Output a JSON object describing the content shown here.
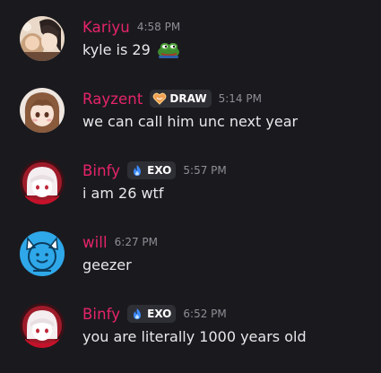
{
  "messages": [
    {
      "username": "Kariyu",
      "timestamp": "4:58 PM",
      "text": "kyle is 29",
      "emoji": "pepe-frog-emoji"
    },
    {
      "username": "Rayzent",
      "badge": {
        "icon": "heart-icon",
        "label": "DRAW"
      },
      "timestamp": "5:14 PM",
      "text": "we can call him unc next year"
    },
    {
      "username": "Binfy",
      "badge": {
        "icon": "flame-icon",
        "label": "EXO"
      },
      "timestamp": "5:57 PM",
      "text": "i am 26 wtf"
    },
    {
      "username": "will",
      "timestamp": "6:27 PM",
      "text": "geezer"
    },
    {
      "username": "Binfy",
      "badge": {
        "icon": "flame-icon",
        "label": "EXO"
      },
      "timestamp": "6:52 PM",
      "text": "you are literally 1000 years old"
    }
  ],
  "colors": {
    "background": "#1a1a1e",
    "username": "#e62468",
    "message_text": "#e8e8ea",
    "timestamp": "#8d8e95",
    "badge_bg": "#2e2f35"
  }
}
